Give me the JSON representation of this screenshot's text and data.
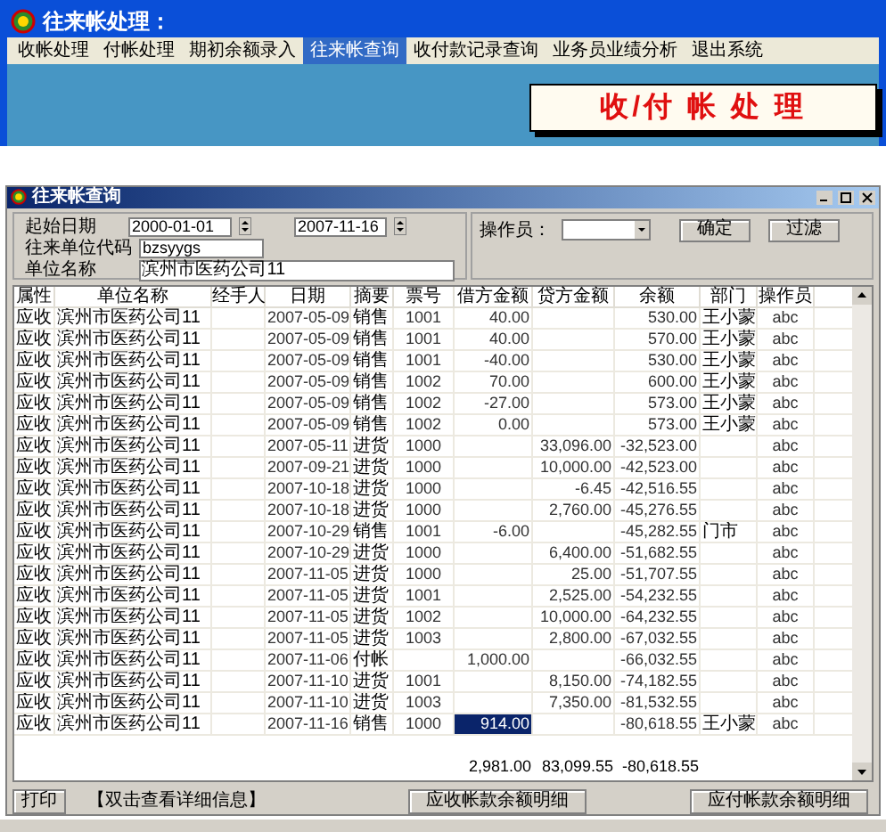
{
  "app_window": {
    "title": "往来帐处理：",
    "menu": [
      {
        "label": "收帐处理",
        "selected": false
      },
      {
        "label": "付帐处理",
        "selected": false
      },
      {
        "label": "期初余额录入",
        "selected": false
      },
      {
        "label": "往来帐查询",
        "selected": true
      },
      {
        "label": "收付款记录查询",
        "selected": false
      },
      {
        "label": "业务员业绩分析",
        "selected": false
      },
      {
        "label": "退出系统",
        "selected": false
      }
    ],
    "banner": "收/付 帐 处 理"
  },
  "query_window": {
    "title": "往来帐查询",
    "filters": {
      "start_date_label": "起始日期",
      "start_date": "2000-01-01",
      "end_date": "2007-11-16",
      "code_label": "往来单位代码",
      "code": "bzsyygs",
      "name_label": "单位名称",
      "name": "滨州市医药公司11",
      "operator_label": "操作员：",
      "confirm_button": "确定",
      "filter_button": "过滤"
    },
    "table": {
      "columns": [
        "属性",
        "单位名称",
        "经手人",
        "日期",
        "摘要",
        "票号",
        "借方金额",
        "贷方金额",
        "余额",
        "部门",
        "操作员"
      ],
      "rows": [
        {
          "type": "应收",
          "unit": "滨州市医药公司11",
          "date": "2007-05-09",
          "summary": "销售",
          "ticket": "1001",
          "debit": "40.00",
          "balance": "530.00",
          "dept": "王小蒙",
          "operator": "abc",
          "selected": false
        },
        {
          "type": "应收",
          "unit": "滨州市医药公司11",
          "date": "2007-05-09",
          "summary": "销售",
          "ticket": "1001",
          "debit": "40.00",
          "balance": "570.00",
          "dept": "王小蒙",
          "operator": "abc",
          "selected": false
        },
        {
          "type": "应收",
          "unit": "滨州市医药公司11",
          "date": "2007-05-09",
          "summary": "销售",
          "ticket": "1001",
          "debit": "-40.00",
          "balance": "530.00",
          "dept": "王小蒙",
          "operator": "abc",
          "selected": false
        },
        {
          "type": "应收",
          "unit": "滨州市医药公司11",
          "date": "2007-05-09",
          "summary": "销售",
          "ticket": "1002",
          "debit": "70.00",
          "balance": "600.00",
          "dept": "王小蒙",
          "operator": "abc",
          "selected": false
        },
        {
          "type": "应收",
          "unit": "滨州市医药公司11",
          "date": "2007-05-09",
          "summary": "销售",
          "ticket": "1002",
          "debit": "-27.00",
          "balance": "573.00",
          "dept": "王小蒙",
          "operator": "abc",
          "selected": false
        },
        {
          "type": "应收",
          "unit": "滨州市医药公司11",
          "date": "2007-05-09",
          "summary": "销售",
          "ticket": "1002",
          "debit": "0.00",
          "balance": "573.00",
          "dept": "王小蒙",
          "operator": "abc",
          "selected": false
        },
        {
          "type": "应收",
          "unit": "滨州市医药公司11",
          "date": "2007-05-11",
          "summary": "进货",
          "ticket": "1000",
          "credit": "33,096.00",
          "balance": "-32,523.00",
          "operator": "abc",
          "selected": false
        },
        {
          "type": "应收",
          "unit": "滨州市医药公司11",
          "date": "2007-09-21",
          "summary": "进货",
          "ticket": "1000",
          "credit": "10,000.00",
          "balance": "-42,523.00",
          "operator": "abc",
          "selected": false
        },
        {
          "type": "应收",
          "unit": "滨州市医药公司11",
          "date": "2007-10-18",
          "summary": "进货",
          "ticket": "1000",
          "credit": "-6.45",
          "balance": "-42,516.55",
          "operator": "abc",
          "selected": false
        },
        {
          "type": "应收",
          "unit": "滨州市医药公司11",
          "date": "2007-10-18",
          "summary": "进货",
          "ticket": "1000",
          "credit": "2,760.00",
          "balance": "-45,276.55",
          "operator": "abc",
          "selected": false
        },
        {
          "type": "应收",
          "unit": "滨州市医药公司11",
          "date": "2007-10-29",
          "summary": "销售",
          "ticket": "1001",
          "debit": "-6.00",
          "balance": "-45,282.55",
          "dept": "门市",
          "operator": "abc",
          "selected": false
        },
        {
          "type": "应收",
          "unit": "滨州市医药公司11",
          "date": "2007-10-29",
          "summary": "进货",
          "ticket": "1000",
          "credit": "6,400.00",
          "balance": "-51,682.55",
          "operator": "abc",
          "selected": false
        },
        {
          "type": "应收",
          "unit": "滨州市医药公司11",
          "date": "2007-11-05",
          "summary": "进货",
          "ticket": "1000",
          "credit": "25.00",
          "balance": "-51,707.55",
          "operator": "abc",
          "selected": false
        },
        {
          "type": "应收",
          "unit": "滨州市医药公司11",
          "date": "2007-11-05",
          "summary": "进货",
          "ticket": "1001",
          "credit": "2,525.00",
          "balance": "-54,232.55",
          "operator": "abc",
          "selected": false
        },
        {
          "type": "应收",
          "unit": "滨州市医药公司11",
          "date": "2007-11-05",
          "summary": "进货",
          "ticket": "1002",
          "credit": "10,000.00",
          "balance": "-64,232.55",
          "operator": "abc",
          "selected": false
        },
        {
          "type": "应收",
          "unit": "滨州市医药公司11",
          "date": "2007-11-05",
          "summary": "进货",
          "ticket": "1003",
          "credit": "2,800.00",
          "balance": "-67,032.55",
          "operator": "abc",
          "selected": false
        },
        {
          "type": "应收",
          "unit": "滨州市医药公司11",
          "date": "2007-11-06",
          "summary": "付帐",
          "debit": "1,000.00",
          "balance": "-66,032.55",
          "operator": "abc",
          "selected": false
        },
        {
          "type": "应收",
          "unit": "滨州市医药公司11",
          "date": "2007-11-10",
          "summary": "进货",
          "ticket": "1001",
          "credit": "8,150.00",
          "balance": "-74,182.55",
          "operator": "abc",
          "selected": false
        },
        {
          "type": "应收",
          "unit": "滨州市医药公司11",
          "date": "2007-11-10",
          "summary": "进货",
          "ticket": "1003",
          "credit": "7,350.00",
          "balance": "-81,532.55",
          "operator": "abc",
          "selected": false
        },
        {
          "type": "应收",
          "unit": "滨州市医药公司11",
          "date": "2007-11-16",
          "summary": "销售",
          "ticket": "1000",
          "debit": "914.00",
          "balance": "-80,618.55",
          "dept": "王小蒙",
          "operator": "abc",
          "selected": true
        }
      ],
      "totals": {
        "debit": "2,981.00",
        "credit": "83,099.55",
        "balance": "-80,618.55"
      }
    },
    "print_button": "打印",
    "hint": "【双击查看详细信息】",
    "receivable_button": "应收帐款余额明细",
    "payable_button": "应付帐款余额明细"
  }
}
